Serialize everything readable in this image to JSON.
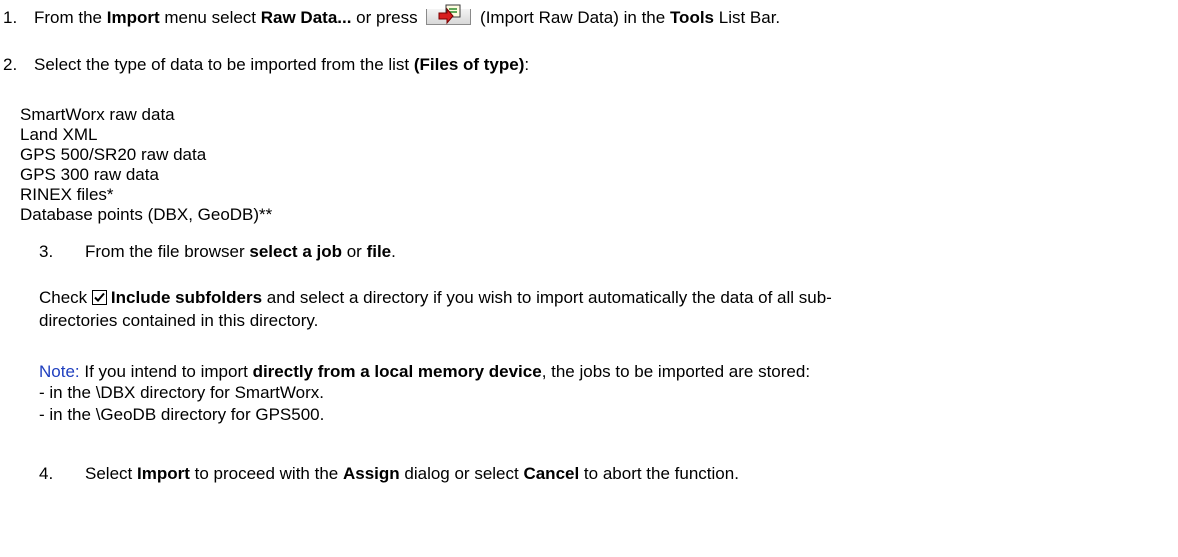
{
  "step1": {
    "number": "1.",
    "text_a": "From the ",
    "menu": "Import",
    "text_b": " menu select ",
    "item": "Raw Data...",
    "text_c": " or press ",
    "text_d": " (Import Raw Data) in the ",
    "listbar": "Tools",
    "text_e": " List Bar."
  },
  "step2": {
    "number": "2.",
    "text_a": "Select the type of data to be imported from the list ",
    "files_of_type": "(Files of type)",
    "text_b": ":"
  },
  "file_types": [
    "SmartWorx raw data",
    "Land XML",
    "GPS 500/SR20 raw data",
    "GPS 300 raw data",
    "RINEX files*",
    "Database points (DBX, GeoDB)**"
  ],
  "step3": {
    "number": "3.",
    "text_a": "From the file browser ",
    "select_job": "select a job",
    "text_b": " or ",
    "file": "file",
    "text_c": "."
  },
  "check": {
    "text_a": "Check ",
    "option": "Include subfolders",
    "text_b": " and select a directory if you wish to import automatically the data of all sub-",
    "line2": "directories contained in this directory."
  },
  "note": {
    "label": "Note:",
    "text_a": " If you intend to import ",
    "bold": "directly from a local memory device",
    "text_b": ", the jobs to be imported are stored:",
    "item1": "- in the \\DBX directory for SmartWorx.",
    "item2": "- in the \\GeoDB directory for GPS500."
  },
  "step4": {
    "number": "4.",
    "text_a": "Select ",
    "import": "Import",
    "text_b": " to proceed with the ",
    "assign": "Assign",
    "text_c": " dialog or select ",
    "cancel": "Cancel",
    "text_d": " to abort the function."
  },
  "icons": {
    "import_raw_data": "import-raw-data-icon",
    "checkbox": "checked-checkbox-icon"
  }
}
